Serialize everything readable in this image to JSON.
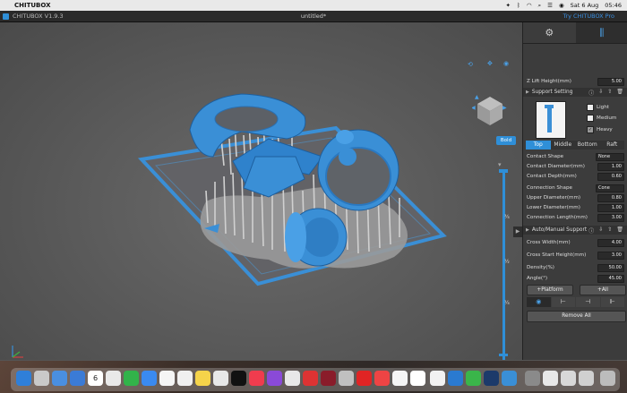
{
  "menubar": {
    "app": "CHITUBOX",
    "date": "Sat 6 Aug",
    "time": "05:46"
  },
  "titlebar": {
    "version": "CHITUBOX V1.9.3",
    "document": "untitled*",
    "pro_link": "Try CHITUBOX Pro"
  },
  "viewport": {
    "mode_button": "Bold",
    "slider_marks": [
      "¾",
      "½",
      "¼"
    ]
  },
  "panel": {
    "z_lift": {
      "label": "Z Lift Height(mm)",
      "value": "5.00"
    },
    "support_setting": {
      "title": "Support Setting"
    },
    "density": [
      {
        "label": "Light",
        "checked": false
      },
      {
        "label": "Medium",
        "checked": false
      },
      {
        "label": "Heavy",
        "checked": true
      }
    ],
    "tabs": [
      "Top",
      "Middle",
      "Bottom",
      "Raft"
    ],
    "top_rows": [
      {
        "label": "Contact Shape",
        "value": "None"
      },
      {
        "label": "Contact Diameter(mm)",
        "value": "1.00"
      },
      {
        "label": "Contact Depth(mm)",
        "value": "0.60"
      },
      {
        "label": "Connection Shape",
        "value": "Cone"
      },
      {
        "label": "Upper Diameter(mm)",
        "value": "0.80"
      },
      {
        "label": "Lower Diameter(mm)",
        "value": "1.00"
      },
      {
        "label": "Connection Length(mm)",
        "value": "3.00"
      }
    ],
    "auto_manual": {
      "title": "Auto/Manual Support"
    },
    "auto_rows": [
      {
        "label": "Cross Width(mm)",
        "value": "4.00"
      },
      {
        "label": "Cross Start Height(mm)",
        "value": "3.00"
      },
      {
        "label": "Density(%)",
        "value": "50.00"
      },
      {
        "label": "Angle(°)",
        "value": "45.00"
      }
    ],
    "platform_button": "+Platform",
    "all_button": "+All",
    "remove_all": "Remove All"
  },
  "dock": {
    "calendar_day": "6"
  },
  "colors": {
    "accent": "#2f8fd8",
    "model": "#3a8fd6",
    "support": "#c8c8c8"
  }
}
